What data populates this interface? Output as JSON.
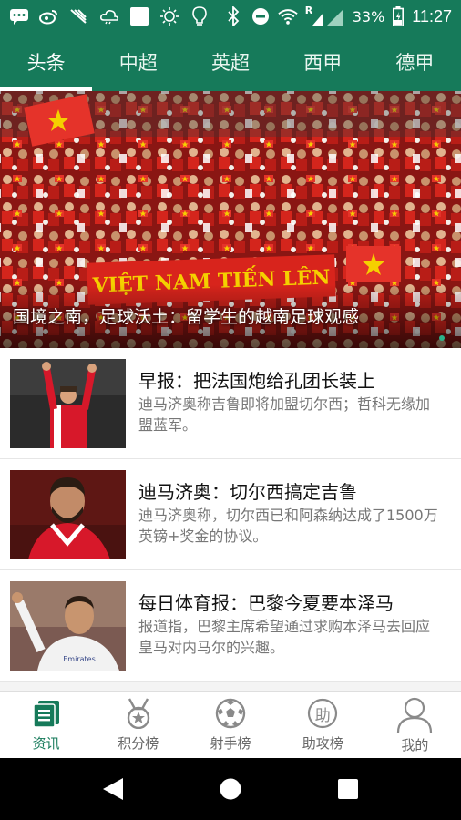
{
  "status_bar": {
    "battery": "33%",
    "time": "11:27",
    "signal_label": "R",
    "icons": [
      "message-icon",
      "weibo-icon",
      "bird-icon",
      "cloud-icon",
      "square-icon",
      "brightness-icon",
      "bulb-icon",
      "bluetooth-icon",
      "dnd-icon",
      "wifi-icon",
      "signal-icon",
      "battery-icon"
    ]
  },
  "tabs": [
    {
      "label": "头条",
      "active": true
    },
    {
      "label": "中超",
      "active": false
    },
    {
      "label": "英超",
      "active": false
    },
    {
      "label": "西甲",
      "active": false
    },
    {
      "label": "德甲",
      "active": false
    }
  ],
  "hero": {
    "banner_text": "VIỆT NAM TIẾN LÊN",
    "caption": "国境之南，足球沃土：留学生的越南足球观感"
  },
  "news": [
    {
      "title": "早报：把法国炮给孔团长装上",
      "desc": "迪马济奥称吉鲁即将加盟切尔西；哲科无缘加盟蓝军。"
    },
    {
      "title": "迪马济奥：切尔西搞定吉鲁",
      "desc": "迪马济奥称，切尔西已和阿森纳达成了1500万英镑+奖金的协议。"
    },
    {
      "title": "每日体育报：巴黎今夏要本泽马",
      "desc": "报道指，巴黎主席希望通过求购本泽马去回应皇马对内马尔的兴趣。"
    }
  ],
  "bottom_nav": [
    {
      "label": "资讯",
      "icon": "news-icon",
      "active": true
    },
    {
      "label": "积分榜",
      "icon": "medal-icon",
      "active": false
    },
    {
      "label": "射手榜",
      "icon": "soccer-ball-icon",
      "active": false
    },
    {
      "label": "助攻榜",
      "icon": "assist-icon",
      "active": false
    },
    {
      "label": "我的",
      "icon": "profile-icon",
      "active": false
    }
  ],
  "assist_glyph": "助",
  "colors": {
    "primary": "#167a5a",
    "crowd_red": "#c8201a",
    "star_yellow": "#f5d000"
  }
}
